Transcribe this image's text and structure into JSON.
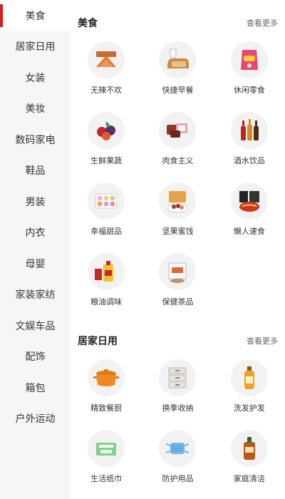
{
  "sidebar": {
    "items": [
      {
        "label": "美食"
      },
      {
        "label": "居家日用"
      },
      {
        "label": "女装"
      },
      {
        "label": "美妆"
      },
      {
        "label": "数码家电"
      },
      {
        "label": "鞋品"
      },
      {
        "label": "男装"
      },
      {
        "label": "内衣"
      },
      {
        "label": "母婴"
      },
      {
        "label": "家装家纺"
      },
      {
        "label": "文娱车品"
      },
      {
        "label": "配饰"
      },
      {
        "label": "箱包"
      },
      {
        "label": "户外运动"
      }
    ]
  },
  "sections": [
    {
      "title": "美食",
      "more": "查看更多",
      "items": [
        {
          "label": "无辣不欢",
          "icon": "meat-snack-icon"
        },
        {
          "label": "快捷早餐",
          "icon": "bread-icon"
        },
        {
          "label": "休闲零食",
          "icon": "chips-icon"
        },
        {
          "label": "生鲜果蔬",
          "icon": "fruit-icon"
        },
        {
          "label": "肉食主义",
          "icon": "meat-icon"
        },
        {
          "label": "酒水饮品",
          "icon": "bottles-icon"
        },
        {
          "label": "幸福甜品",
          "icon": "macaron-icon"
        },
        {
          "label": "坚果蜜饯",
          "icon": "nuts-icon"
        },
        {
          "label": "懒人速食",
          "icon": "noodles-icon"
        },
        {
          "label": "粮油调味",
          "icon": "oil-icon"
        },
        {
          "label": "保健茶品",
          "icon": "tea-icon"
        }
      ]
    },
    {
      "title": "居家日用",
      "more": "查看更多",
      "items": [
        {
          "label": "精致餐厨",
          "icon": "pot-icon"
        },
        {
          "label": "换季收纳",
          "icon": "storage-icon"
        },
        {
          "label": "洗发护发",
          "icon": "shampoo-icon"
        },
        {
          "label": "生活纸巾",
          "icon": "tissue-icon"
        },
        {
          "label": "防护用品",
          "icon": "mask-icon"
        },
        {
          "label": "家庭清洁",
          "icon": "cleaner-icon"
        }
      ]
    }
  ],
  "colors": {
    "accent": "#d71c1e",
    "sidebar_bg": "#f6f6f6",
    "thumb_bg": "#f2f2f2"
  }
}
